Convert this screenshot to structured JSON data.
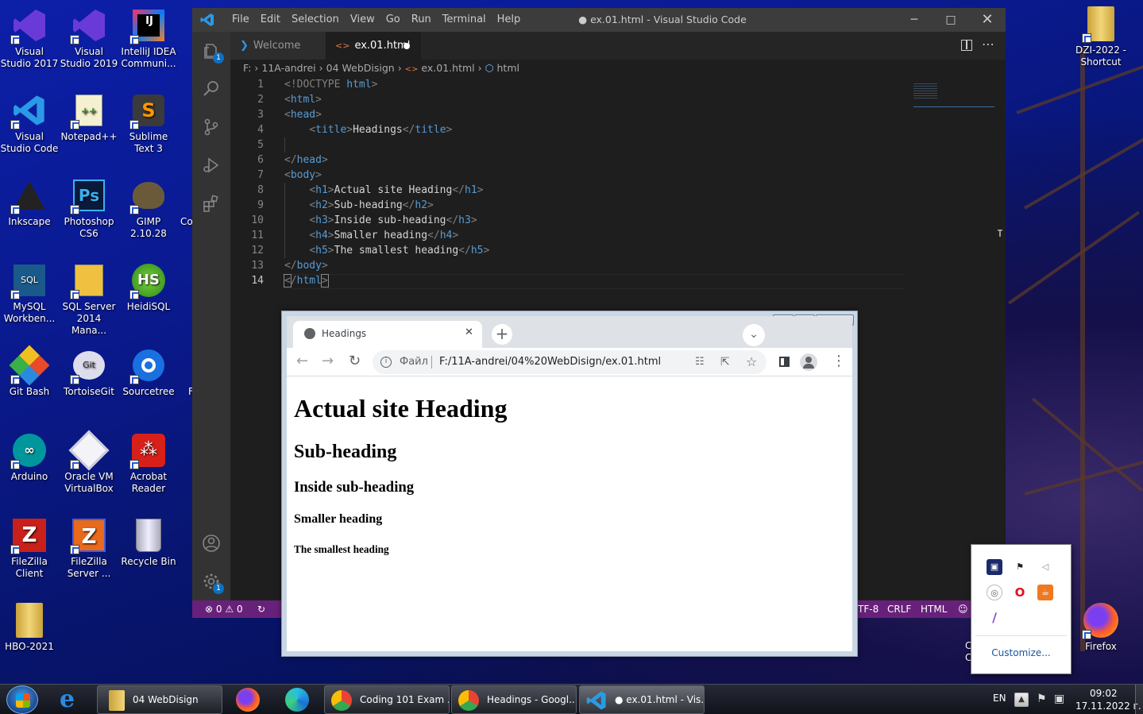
{
  "desktop": {
    "icons_left": [
      {
        "label": "Visual Studio 2017",
        "icon": "visual-studio-icon"
      },
      {
        "label": "Visual Studio 2019",
        "icon": "visual-studio-icon"
      },
      {
        "label": "IntelliJ IDEA Communi...",
        "icon": "intellij-icon"
      },
      {
        "label": "Visual Studio Code",
        "icon": "vscode-icon"
      },
      {
        "label": "Notepad++",
        "icon": "notepad-plus-icon"
      },
      {
        "label": "Sublime Text 3",
        "icon": "sublime-icon"
      },
      {
        "label": "Inkscape",
        "icon": "inkscape-icon"
      },
      {
        "label": "Photoshop CS6",
        "icon": "photoshop-icon"
      },
      {
        "label": "GIMP 2.10.28",
        "icon": "gimp-icon"
      },
      {
        "label": "MySQL Workben...",
        "icon": "mysql-icon"
      },
      {
        "label": "SQL Server 2014 Mana...",
        "icon": "sql-server-icon"
      },
      {
        "label": "HeidiSQL",
        "icon": "heidisql-icon"
      },
      {
        "label": "Git Bash",
        "icon": "git-bash-icon"
      },
      {
        "label": "TortoiseGit",
        "icon": "tortoisegit-icon"
      },
      {
        "label": "Sourcetree",
        "icon": "sourcetree-icon"
      },
      {
        "label": "Arduino",
        "icon": "arduino-icon"
      },
      {
        "label": "Oracle VM VirtualBox",
        "icon": "virtualbox-icon"
      },
      {
        "label": "Acrobat Reader",
        "icon": "acrobat-icon"
      },
      {
        "label": "FileZilla Client",
        "icon": "filezilla-icon"
      },
      {
        "label": "FileZilla Server ...",
        "icon": "filezilla-server-icon"
      },
      {
        "label": "Recycle Bin",
        "icon": "recycle-bin-icon"
      },
      {
        "label": "HBO-2021",
        "icon": "folder-icon"
      }
    ],
    "partial_labels": [
      "Co",
      "F",
      "C",
      "C"
    ],
    "icon_dzi": "DZI-2022 - Shortcut",
    "icon_firefox": "Firefox"
  },
  "vscode": {
    "menu": [
      "File",
      "Edit",
      "Selection",
      "View",
      "Go",
      "Run",
      "Terminal",
      "Help"
    ],
    "window_title": "● ex.01.html - Visual Studio Code",
    "tabs": {
      "welcome": "Welcome",
      "active": "ex.01.html"
    },
    "breadcrumb": [
      "F:",
      "11A-andrei",
      "04 WebDisign",
      "ex.01.html",
      "html"
    ],
    "explorer_badge": "1",
    "settings_badge": "1",
    "line_numbers": [
      "1",
      "2",
      "3",
      "4",
      "5",
      "6",
      "7",
      "8",
      "9",
      "10",
      "11",
      "12",
      "13",
      "14"
    ],
    "code": {
      "l1a": "<!DOCTYPE ",
      "l1b": "html",
      "l1c": ">",
      "l2": "html",
      "l3": "head",
      "l4_tag": "title",
      "l4_text": "Headings",
      "l4_close": "title",
      "l6": "head",
      "l7": "body",
      "l8_tag": "h1",
      "l8_text": "Actual site Heading",
      "l9_tag": "h2",
      "l9_text": "Sub-heading",
      "l10_tag": "h3",
      "l10_text": "Inside sub-heading",
      "l11_tag": "h4",
      "l11_text": "Smaller heading",
      "l12_tag": "h5",
      "l12_text": "The smallest heading",
      "l13": "body",
      "l14": "html"
    },
    "status": {
      "errors": "0",
      "warnings": "0",
      "encoding": "TF-8",
      "eol": "CRLF",
      "language": "HTML"
    }
  },
  "chrome": {
    "tab_title": "Headings",
    "address_label": "Файл",
    "url": "F:/11A-andrei/04%20WebDisign/ex.01.html",
    "headings": {
      "h1": "Actual site Heading",
      "h2": "Sub-heading",
      "h3": "Inside sub-heading",
      "h4": "Smaller heading",
      "h5": "The smallest heading"
    }
  },
  "tray_popup": {
    "customize": "Customize..."
  },
  "taskbar": {
    "buttons": [
      {
        "label": "04 WebDisign",
        "icon": "folder-icon"
      },
      {
        "label": "Coding 101 Exam ...",
        "icon": "chrome-icon"
      },
      {
        "label": "Headings - Googl...",
        "icon": "chrome-icon"
      },
      {
        "label": "● ex.01.html - Vis...",
        "icon": "vscode-icon"
      }
    ],
    "lang": "EN",
    "time": "09:02",
    "date": "17.11.2022 г."
  }
}
